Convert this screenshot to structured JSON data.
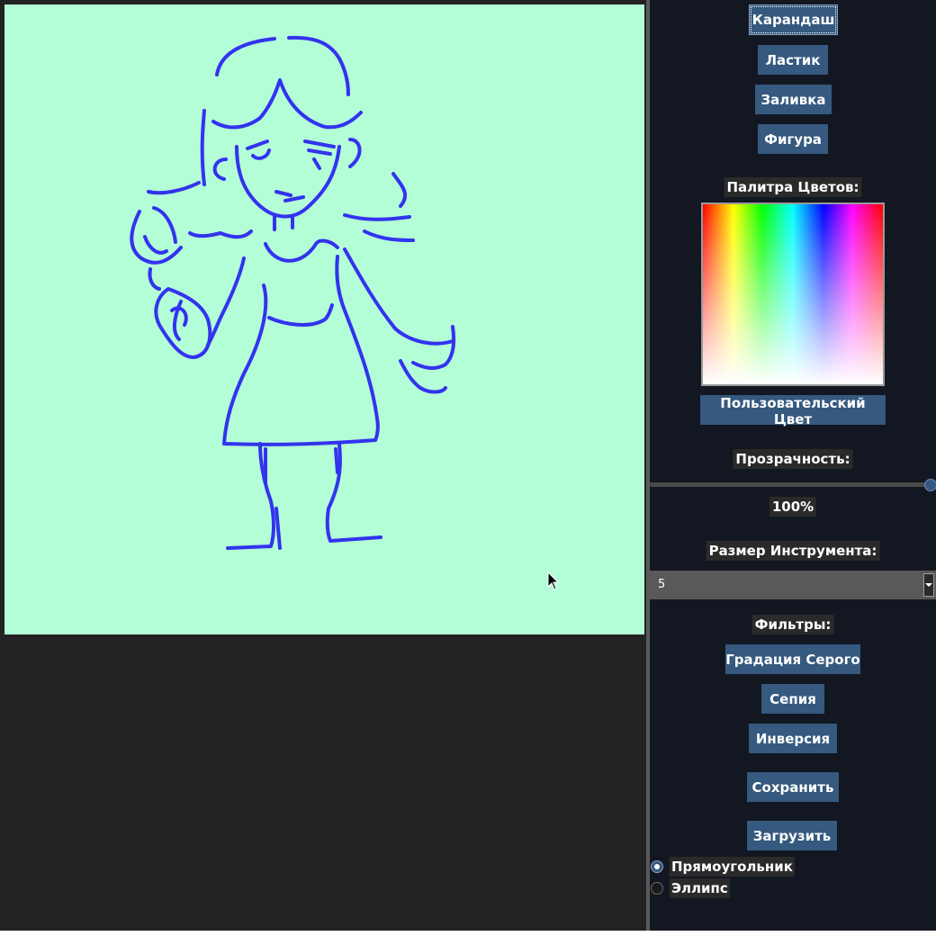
{
  "colors": {
    "canvas_bg": "#b3fdd7",
    "stroke": "#3333ee",
    "panel_bg": "#131722",
    "button_bg": "#35597f",
    "workspace_bg": "#222222"
  },
  "tools": {
    "pencil": "Карандаш",
    "eraser": "Ластик",
    "fill": "Заливка",
    "shape": "Фигура",
    "active": "pencil"
  },
  "palette": {
    "label": "Палитра Цветов:",
    "custom_color": "Пользовательский Цвет"
  },
  "opacity": {
    "label": "Прозрачность:",
    "value_text": "100%",
    "level": 1.0
  },
  "tool_size": {
    "label": "Размер Инструмента:",
    "value": "5"
  },
  "filters": {
    "label": "Фильтры:",
    "grayscale": "Градация Серого",
    "sepia": "Сепия",
    "invert": "Инверсия"
  },
  "file": {
    "save": "Сохранить",
    "load": "Загрузить"
  },
  "shape_options": [
    {
      "label": "Прямоугольник",
      "checked": true
    },
    {
      "label": "Эллипс",
      "checked": false
    }
  ],
  "icons": {
    "cursor": "arrow-cursor-icon",
    "dropdown": "chevron-down-icon"
  }
}
